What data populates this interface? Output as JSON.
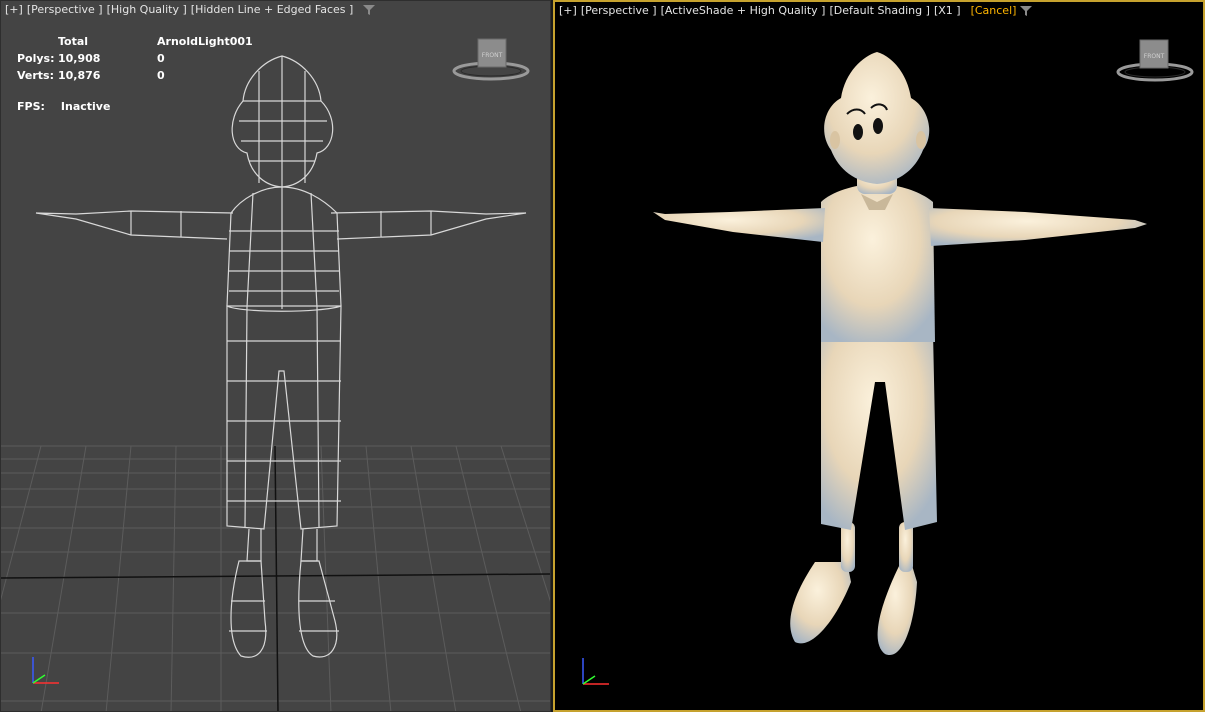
{
  "left_viewport": {
    "labels": [
      "[+]",
      "[Perspective ]",
      "[High Quality ]",
      "[Hidden Line + Edged Faces ]"
    ],
    "stats": {
      "headers": [
        "",
        "Total",
        "ArnoldLight001"
      ],
      "rows": [
        {
          "label": "Polys:",
          "total": "10,908",
          "selected": "0"
        },
        {
          "label": "Verts:",
          "total": "10,876",
          "selected": "0"
        }
      ]
    },
    "fps_label": "FPS:",
    "fps_value": "Inactive",
    "viewcube_face": "FRONT"
  },
  "right_viewport": {
    "labels": [
      "[+]",
      "[Perspective ]",
      "[ActiveShade + High Quality ]",
      "[Default Shading ]",
      "[X1 ]"
    ],
    "cancel_label": "[Cancel]",
    "viewcube_face": "FRONT",
    "border_color": "#c6a22e"
  },
  "icons": {
    "filter": "filter-funnel-icon",
    "viewcube": "viewcube-icon",
    "axis": "axis-tripod-icon"
  },
  "colors": {
    "wire": "#d8d8d8",
    "grid": "#5e5e5e",
    "cancel": "#ffb500",
    "render_body": "#efe3cc"
  }
}
